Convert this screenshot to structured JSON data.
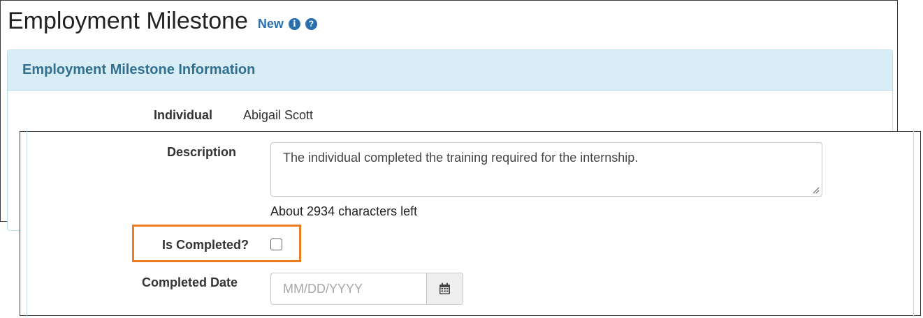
{
  "header": {
    "title": "Employment Milestone",
    "new_label": "New",
    "info_icon": "info-icon",
    "help_icon": "help-icon"
  },
  "panel": {
    "title": "Employment Milestone Information"
  },
  "fields": {
    "individual": {
      "label": "Individual",
      "value": "Abigail Scott"
    },
    "description": {
      "label": "Description",
      "value": "The individual completed the training required for the internship.",
      "chars_left": "About 2934 characters left"
    },
    "is_completed": {
      "label": "Is Completed?",
      "checked": false
    },
    "completed_date": {
      "label": "Completed Date",
      "placeholder": "MM/DD/YYYY",
      "button_icon": "calendar-icon"
    }
  },
  "colors": {
    "link": "#2a6fad",
    "panel_header_bg": "#d9edf7",
    "panel_title": "#31708f",
    "highlight": "#ee7d22"
  }
}
